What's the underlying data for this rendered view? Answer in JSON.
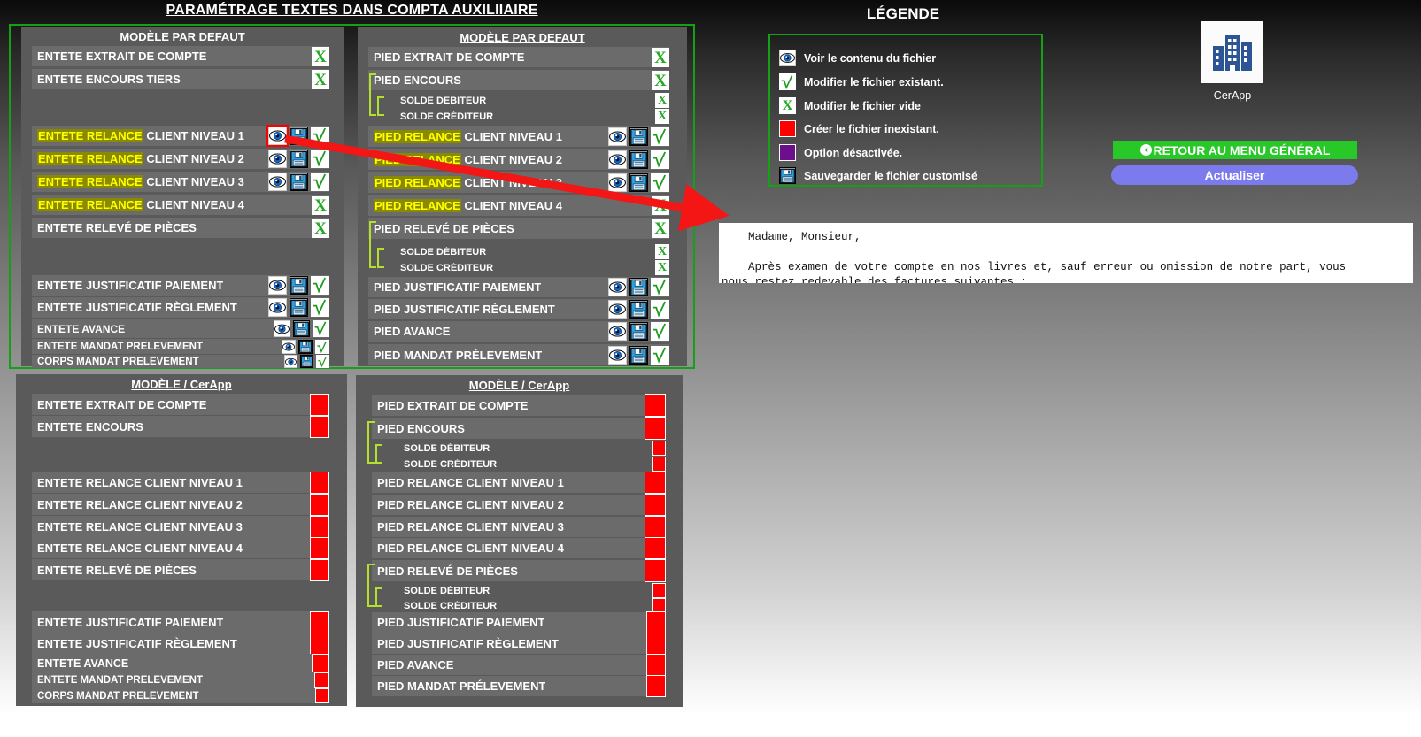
{
  "page": {
    "title": "PARAMÉTRAGE TEXTES DANS COMPTA AUXILIIAIRE"
  },
  "colors": {
    "frame_green": "#15a015",
    "highlight_bg": "#8a8a00",
    "highlight_text": "#ffff00",
    "red": "#ff0000",
    "purple": "#6b0f8c",
    "tree": "#b3e02a",
    "btn_green": "#29c829",
    "btn_purple": "#7b7bee",
    "panel_bg": "#5a5a5a",
    "row_bg": "#6b6b6b"
  },
  "panels": {
    "top_left": {
      "title": "MODÈLE PAR DEFAUT",
      "rows": [
        {
          "label": "ENTETE EXTRAIT DE COMPTE",
          "icons": [
            "x"
          ]
        },
        {
          "label": "ENTETE ENCOURS TIERS",
          "icons": [
            "x"
          ]
        },
        {
          "hl": "ENTETE RELANCE",
          "label": " CLIENT NIVEAU 1",
          "icons": [
            "eye-selected",
            "save",
            "check"
          ]
        },
        {
          "hl": "ENTETE RELANCE",
          "label": " CLIENT NIVEAU 2",
          "icons": [
            "eye",
            "save",
            "check"
          ]
        },
        {
          "hl": "ENTETE RELANCE",
          "label": " CLIENT NIVEAU 3",
          "icons": [
            "eye",
            "save",
            "check"
          ]
        },
        {
          "hl": "ENTETE RELANCE",
          "label": " CLIENT NIVEAU 4",
          "icons": [
            "x"
          ]
        },
        {
          "label": "ENTETE RELEVÉ DE PIÈCES",
          "icons": [
            "x"
          ]
        },
        {
          "label": "ENTETE JUSTIFICATIF PAIEMENT",
          "icons": [
            "eye",
            "save",
            "check"
          ]
        },
        {
          "label": "ENTETE JUSTIFICATIF RÈGLEMENT",
          "icons": [
            "eye",
            "save",
            "check"
          ]
        },
        {
          "label": "ENTETE AVANCE",
          "icons": [
            "eye",
            "save",
            "check"
          ]
        },
        {
          "label": "ENTETE MANDAT PRÉLEVEMENT",
          "icons": [
            "eye",
            "save",
            "check"
          ]
        },
        {
          "label": "CORPS MANDAT PRÉLEVEMENT",
          "icons": [
            "eye",
            "save",
            "check"
          ]
        }
      ]
    },
    "top_right": {
      "title": "MODÈLE PAR DEFAUT",
      "rows": [
        {
          "label": "PIED EXTRAIT DE COMPTE",
          "icons": [
            "x"
          ]
        },
        {
          "label": "PIED ENCOURS",
          "icons": [
            "x"
          ]
        },
        {
          "label": "SOLDE DÉBITEUR",
          "sub": true,
          "icons": [
            "x"
          ]
        },
        {
          "label": "SOLDE CRÉDITEUR",
          "sub": true,
          "icons": [
            "x"
          ]
        },
        {
          "hl": "PIED RELANCE",
          "label": " CLIENT NIVEAU 1",
          "icons": [
            "eye",
            "save",
            "check"
          ]
        },
        {
          "hl": "PIED RELANCE",
          "label": " CLIENT NIVEAU 2",
          "icons": [
            "eye",
            "save",
            "check"
          ]
        },
        {
          "hl": "PIED RELANCE",
          "label": " CLIENT NIVEAU 3",
          "icons": [
            "eye",
            "save",
            "check"
          ]
        },
        {
          "hl": "PIED RELANCE",
          "label": " CLIENT NIVEAU 4",
          "icons": [
            "x"
          ]
        },
        {
          "label": "PIED RELEVÉ DE PIÈCES",
          "icons": [
            "x"
          ]
        },
        {
          "label": "SOLDE DÉBITEUR",
          "sub": true,
          "icons": [
            "x"
          ]
        },
        {
          "label": "SOLDE CRÉDITEUR",
          "sub": true,
          "icons": [
            "x"
          ]
        },
        {
          "label": "PIED JUSTIFICATIF PAIEMENT",
          "icons": [
            "eye",
            "save",
            "check"
          ]
        },
        {
          "label": "PIED JUSTIFICATIF RÈGLEMENT",
          "icons": [
            "eye",
            "save",
            "check"
          ]
        },
        {
          "label": "PIED AVANCE",
          "icons": [
            "eye",
            "save",
            "check"
          ]
        },
        {
          "label": "PIED MANDAT PRÉLEVEMENT",
          "icons": [
            "eye",
            "save",
            "check"
          ]
        }
      ]
    },
    "bottom_left": {
      "title": "MODÈLE / CerApp",
      "rows": [
        {
          "label": "ENTETE EXTRAIT DE COMPTE",
          "icons": [
            "red"
          ]
        },
        {
          "label": "ENTETE ENCOURS",
          "icons": [
            "red"
          ]
        },
        {
          "label": "ENTETE RELANCE CLIENT NIVEAU 1",
          "icons": [
            "red"
          ]
        },
        {
          "label": "ENTETE RELANCE CLIENT NIVEAU 2",
          "icons": [
            "red"
          ]
        },
        {
          "label": "ENTETE RELANCE CLIENT NIVEAU 3",
          "icons": [
            "red"
          ]
        },
        {
          "label": "ENTETE RELANCE CLIENT NIVEAU 4",
          "icons": [
            "red"
          ]
        },
        {
          "label": "ENTETE RELEVÉ DE PIÈCES",
          "icons": [
            "red"
          ]
        },
        {
          "label": "ENTETE JUSTIFICATIF PAIEMENT",
          "icons": [
            "red"
          ]
        },
        {
          "label": "ENTETE JUSTIFICATIF RÈGLEMENT",
          "icons": [
            "red"
          ]
        },
        {
          "label": "ENTETE AVANCE",
          "icons": [
            "red"
          ]
        },
        {
          "label": "ENTETE MANDAT PRÉLEVEMENT",
          "icons": [
            "red"
          ]
        },
        {
          "label": "CORPS MANDAT PRÉLEVEMENT",
          "icons": [
            "red"
          ]
        }
      ]
    },
    "bottom_right": {
      "title": "MODÈLE / CerApp",
      "rows": [
        {
          "label": "PIED EXTRAIT DE COMPTE",
          "icons": [
            "red"
          ]
        },
        {
          "label": "PIED ENCOURS",
          "icons": [
            "red"
          ]
        },
        {
          "label": "SOLDE DÉBITEUR",
          "sub": true,
          "icons": [
            "red"
          ]
        },
        {
          "label": "SOLDE CRÉDITEUR",
          "sub": true,
          "icons": [
            "red"
          ]
        },
        {
          "label": "PIED RELANCE CLIENT NIVEAU 1",
          "icons": [
            "red"
          ]
        },
        {
          "label": "PIED RELANCE CLIENT NIVEAU 2",
          "icons": [
            "red"
          ]
        },
        {
          "label": "PIED RELANCE CLIENT NIVEAU 3",
          "icons": [
            "red"
          ]
        },
        {
          "label": "PIED RELANCE CLIENT NIVEAU 4",
          "icons": [
            "red"
          ]
        },
        {
          "label": "PIED RELEVÉ DE PIÈCES",
          "icons": [
            "red"
          ]
        },
        {
          "label": "SOLDE DÉBITEUR",
          "sub": true,
          "icons": [
            "red"
          ]
        },
        {
          "label": "SOLDE CRÉDITEUR",
          "sub": true,
          "icons": [
            "red"
          ]
        },
        {
          "label": "PIED JUSTIFICATIF PAIEMENT",
          "icons": [
            "red"
          ]
        },
        {
          "label": "PIED JUSTIFICATIF RÈGLEMENT",
          "icons": [
            "red"
          ]
        },
        {
          "label": "PIED AVANCE",
          "icons": [
            "red"
          ]
        },
        {
          "label": "PIED MANDAT PRÉLEVEMENT",
          "icons": [
            "red"
          ]
        }
      ]
    }
  },
  "legend": {
    "title": "LÉGENDE",
    "items": [
      {
        "icon": "eye-icon",
        "label": "Voir le contenu du fichier"
      },
      {
        "icon": "check-icon",
        "label": "Modifier le fichier existant."
      },
      {
        "icon": "x-icon",
        "label": "Modifier le fichier vide"
      },
      {
        "icon": "red-square",
        "label": "Créer le fichier inexistant."
      },
      {
        "icon": "purple-square",
        "label": "Option désactivée."
      },
      {
        "icon": "save-icon",
        "label": "Sauvegarder le fichier customisé"
      }
    ]
  },
  "cerapp": {
    "label": "CerApp"
  },
  "buttons": {
    "retour": "RETOUR AU MENU GÉNÉRAL",
    "actualiser": "Actualiser"
  },
  "preview": {
    "text": "    Madame, Monsieur,\n\n    Après examen de votre compte en nos livres et, sauf erreur ou omission de notre part, vous\nnous restez redevable des factures suivantes :"
  }
}
